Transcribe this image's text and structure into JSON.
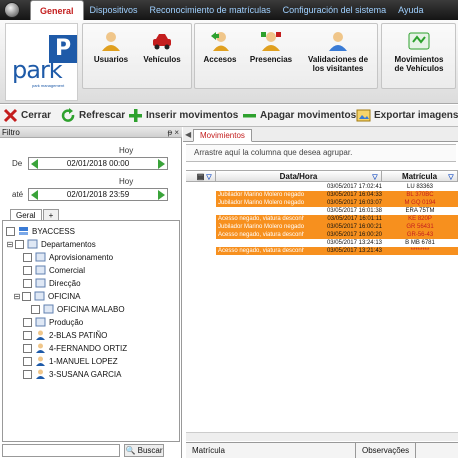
{
  "menu_tabs": [
    "General",
    "Dispositivos",
    "Reconocimiento de matrículas",
    "Configuración del sistema",
    "Ayuda"
  ],
  "logo": {
    "letter": "P",
    "text": "park",
    "sub": "park management"
  },
  "ribbon": {
    "buttons": [
      {
        "label": "Usuarios",
        "icon": "users-icon"
      },
      {
        "label": "Vehículos",
        "icon": "car-icon"
      },
      {
        "label": "Accesos",
        "icon": "access-icon"
      },
      {
        "label": "Presencias",
        "icon": "presence-icon"
      },
      {
        "label": "Validaciones de los visitantes",
        "line1": "Validaciones de",
        "line2": "los visitantes",
        "icon": "visitor-validation-icon"
      },
      {
        "label": "Movimientos de Vehículos",
        "line1": "Movimientos",
        "line2": "de Vehículos",
        "icon": "vehicle-movements-icon"
      }
    ]
  },
  "toolbar": {
    "close": "Cerrar",
    "refresh": "Refrescar",
    "insert": "Inserir movimentos",
    "delete": "Apagar movimentos",
    "export": "Exportar imagens d"
  },
  "filter": {
    "title": "Filtro",
    "buttons": "ᵽ ×",
    "hoy1": "Hoy",
    "de_label": "De",
    "de_value": "02/01/2018 00:00",
    "hoy2": "Hoy",
    "ate_label": "até",
    "ate_value": "02/01/2018 23:59",
    "tab_general": "Geral",
    "tab_add": "+",
    "search_button": "Buscar"
  },
  "tree": [
    {
      "label": "BYACCESS",
      "level": 0,
      "type": "root"
    },
    {
      "label": "Departamentos",
      "level": 0,
      "type": "folder",
      "expanded": true
    },
    {
      "label": "Aprovisionamento",
      "level": 1,
      "type": "dept"
    },
    {
      "label": "Comercial",
      "level": 1,
      "type": "dept"
    },
    {
      "label": "Direcção",
      "level": 1,
      "type": "dept"
    },
    {
      "label": "OFICINA",
      "level": 1,
      "type": "folder",
      "expanded": true
    },
    {
      "label": "OFICINA MALABO",
      "level": 2,
      "type": "dept"
    },
    {
      "label": "Produção",
      "level": 1,
      "type": "dept"
    },
    {
      "label": "2-BLAS PATIÑO",
      "level": 1,
      "type": "person"
    },
    {
      "label": "4-FERNANDO ORTIZ",
      "level": 1,
      "type": "person"
    },
    {
      "label": "1-MANUEL LOPEZ",
      "level": 1,
      "type": "person"
    },
    {
      "label": "3-SUSANA GARCIA",
      "level": 1,
      "type": "person"
    }
  ],
  "movements": {
    "tab": "Movimientos",
    "group_hint": "Arrastre aquí la columna que desea agrupar.",
    "columns": [
      "Data/Hora",
      "Matrícula"
    ],
    "rows": [
      {
        "desc": "",
        "date": "03/05/2017 17:02:41",
        "plate": "LU 83363",
        "color": "#ffffff"
      },
      {
        "desc": "Jubilador Marino Molero negado",
        "date": "03/05/2017 16:04:33",
        "plate": "BL 370BC",
        "color": "#f7901e"
      },
      {
        "desc": "Jubilador Marino Molero negado",
        "date": "03/05/2017 16:03:07",
        "plate": "M GQ 0194",
        "color": "#f7901e"
      },
      {
        "desc": "",
        "date": "03/05/2017 16:01:38",
        "plate": "ERA 75TM",
        "color": "#ffffff"
      },
      {
        "desc": "Acesso negado, viatura desconhecida",
        "date": "03/05/2017 16:01:11",
        "plate": "KE 820P",
        "color": "#f7901e"
      },
      {
        "desc": "Jubilador Marino Molero negado",
        "date": "03/05/2017 16:00:21",
        "plate": "GR 56431",
        "color": "#f7901e"
      },
      {
        "desc": "Acesso negado, viatura desconhecida",
        "date": "03/05/2017 16:00:20",
        "plate": "GR-56-43",
        "color": "#f7901e"
      },
      {
        "desc": "",
        "date": "03/05/2017 13:24:13",
        "plate": "B MB 6781",
        "color": "#ffffff"
      },
      {
        "desc": "Acesso negado, viatura desconhecida",
        "date": "03/05/2017 13:21:43",
        "plate": "********",
        "color": "#f7901e"
      }
    ],
    "bottom_tabs": [
      "Matrícula",
      "Observações"
    ]
  }
}
